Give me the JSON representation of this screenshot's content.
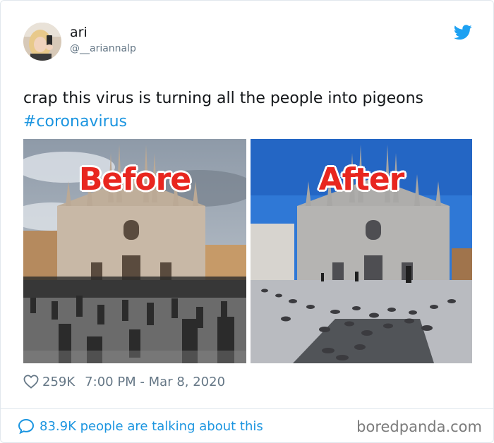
{
  "tweet": {
    "author_name": "ari",
    "author_handle": "@__ariannalp",
    "text": "crap this virus is turning all the people into pigeons ",
    "hashtag": "#coronavirus",
    "images": [
      {
        "label": "Before",
        "description": "Milan cathedral square crowded with people"
      },
      {
        "label": "After",
        "description": "Empty Milan cathedral square with pigeons"
      }
    ],
    "likes": "259K",
    "timestamp": "7:00 PM - Mar 8, 2020",
    "discussion": "83.9K people are talking about this"
  },
  "watermark": "boredpanda.com",
  "icons": {
    "brand": "twitter-bird-icon",
    "like": "heart-icon",
    "reply": "speech-bubble-icon"
  },
  "colors": {
    "link": "#1b95e0",
    "secondary_text": "#657786",
    "label_red": "#e8261f"
  }
}
